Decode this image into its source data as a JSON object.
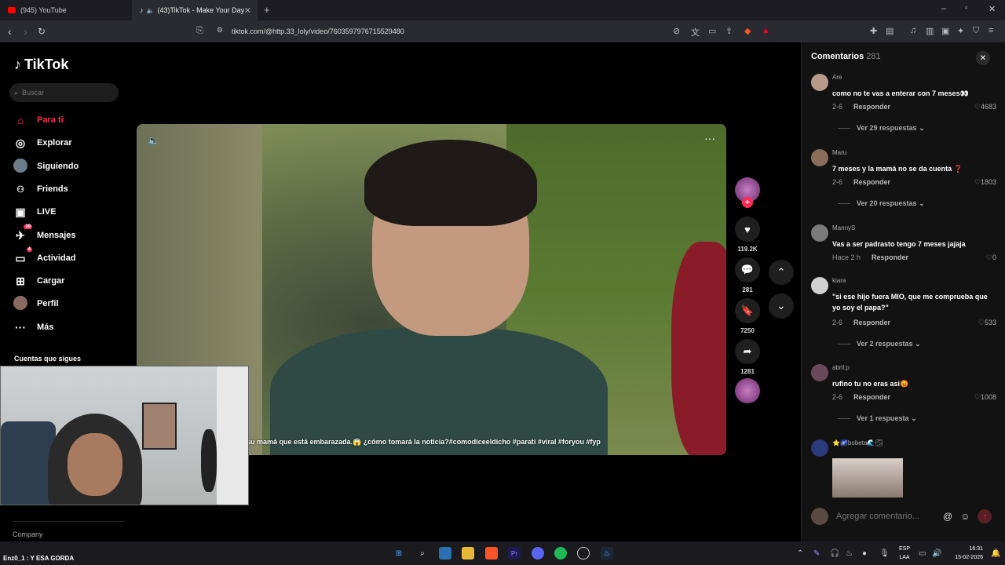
{
  "browser": {
    "tabs": [
      {
        "title": "(945) YouTube",
        "favicon_color": "#ff0000"
      },
      {
        "title": "(43)TikTok - Make Your Day",
        "favicon_color": "#ffffff"
      }
    ],
    "new_tab": "+",
    "url": "tiktok.com/@http.33_loly/video/7603597976715529480"
  },
  "sidebar": {
    "logo": "TikTok",
    "search_placeholder": "Buscar",
    "items": [
      {
        "label": "Para ti",
        "icon": "home-icon",
        "glyph": "⌂"
      },
      {
        "label": "Explorar",
        "icon": "compass-icon",
        "glyph": "◎"
      },
      {
        "label": "Siguiendo",
        "icon": "following-avatar-icon",
        "glyph": ""
      },
      {
        "label": "Friends",
        "icon": "friends-icon",
        "glyph": "👥"
      },
      {
        "label": "LIVE",
        "icon": "live-icon",
        "glyph": "▣"
      },
      {
        "label": "Mensajes",
        "icon": "messages-icon",
        "glyph": "✈",
        "badge": "39"
      },
      {
        "label": "Actividad",
        "icon": "activity-icon",
        "glyph": "▭",
        "badge": "4"
      },
      {
        "label": "Cargar",
        "icon": "upload-icon",
        "glyph": "⊞"
      },
      {
        "label": "Perfil",
        "icon": "profile-avatar-icon",
        "glyph": ""
      },
      {
        "label": "Más",
        "icon": "more-icon",
        "glyph": "···"
      }
    ],
    "following_heading": "Cuentas que sigues",
    "company": "Company"
  },
  "video": {
    "caption": "su mamá que está embarazada.😱 ¿cómo tomará la noticia?#comodiceeldicho #parati #viral #foryou #fyp",
    "likes": "119.2K",
    "comments": "281",
    "saves": "7250",
    "shares": "1281"
  },
  "comments_panel": {
    "title": "Comentarios",
    "count": "281",
    "input_placeholder": "Agregar comentario...",
    "reply_label": "Responder",
    "comments": [
      {
        "user": "Are",
        "text": "como no te vas a enterar con 7 meses👀",
        "date": "2-6",
        "likes": "4683",
        "replies": "Ver 29 respuestas",
        "avatar_color": "#b89a8a"
      },
      {
        "user": "Maru",
        "text": "7 meses y la mamá no se da cuenta ❓",
        "date": "2-6",
        "likes": "1803",
        "replies": "Ver 20 respuestas",
        "avatar_color": "#8a6e5a"
      },
      {
        "user": "MannyS",
        "text": "Vas a ser padrasto tengo 7 meses jajaja",
        "date": "Hace 2 h",
        "likes": "0",
        "replies": "",
        "avatar_color": "#7a7a7a"
      },
      {
        "user": "kiara",
        "text": "\"si ese hijo fuera MIO, que me comprueba que yo soy el papa?\"",
        "date": "2-6",
        "likes": "533",
        "replies": "Ver 2 respuestas",
        "avatar_color": "#d0d0d0"
      },
      {
        "user": "abril;p",
        "text": "rufino tu no eras asi😡",
        "date": "2-6",
        "likes": "1008",
        "replies": "Ver 1 respuesta",
        "avatar_color": "#6a4a5a"
      },
      {
        "user": "⭐🌌bobeta🌊🌫",
        "text": "",
        "date": "",
        "likes": "",
        "replies": "",
        "avatar_color": "#2a3a7a"
      }
    ]
  },
  "taskbar": {
    "chat_text": "Enz0_1 : Y ESA GORDA",
    "lang_top": "ESP",
    "lang_bottom": "LAA",
    "time": "16:31",
    "date": "15-02-2026"
  }
}
